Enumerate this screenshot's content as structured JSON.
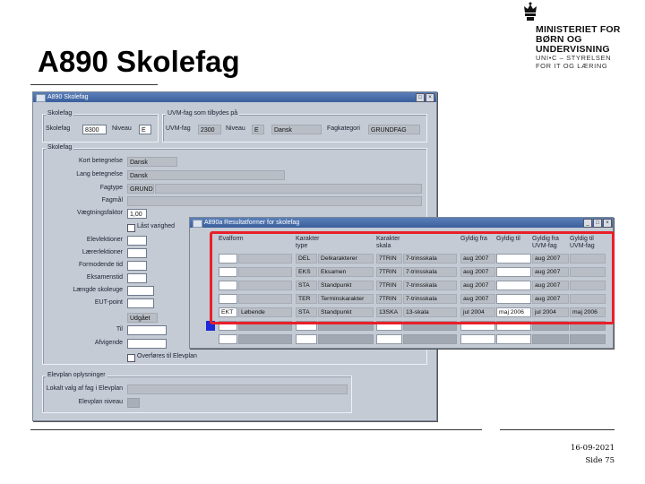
{
  "slide": {
    "title": "A890 Skolefag",
    "date": "16-09-2021",
    "page": "Side 75"
  },
  "logo": {
    "line1": "MINISTERIET FOR",
    "line2": "BØRN OG",
    "line3": "UNDERVISNING",
    "line4": "UNI•C – STYRELSEN",
    "line5": "FOR IT OG LÆRING"
  },
  "main_window": {
    "title": "A890 Skolefag",
    "panel_skolefag": {
      "label": "Skolefag",
      "skolefag_label": "Skolefag",
      "skolefag_value": "8300",
      "niveau_label": "Niveau",
      "niveau_value": "E"
    },
    "panel_uvm": {
      "label": "UVM-fag som tilbydes på",
      "uvmfag_label": "UVM-fag",
      "uvmfag_value": "2300",
      "niveau_label": "Niveau",
      "niveau_value": "E",
      "name_value": "Dansk",
      "fagkategori_label": "Fagkategori",
      "fagkategori_value": "GRUNDFAG"
    },
    "panel_details": {
      "label": "Skolefag",
      "kort_label": "Kort betegnelse",
      "kort_value": "Dansk",
      "lang_label": "Lang betegnelse",
      "lang_value": "Dansk",
      "fagtype_label": "Fagtype",
      "fagtype_value": "GRUNDF",
      "fagmal_label": "Fagmål",
      "vaegt_label": "Vægtningsfaktor",
      "vaegt_value": "1,00",
      "laast_label": "Låst varighed",
      "elevlek_label": "Elevlektioner",
      "laererlek_label": "Lærerlektioner",
      "formodende_label": "Formodende tid",
      "eksamen_label": "Eksamenstid",
      "laengde_label": "Længde skoleuge",
      "eut_label": "EUT-point",
      "status_value": "Udgået",
      "tilg_label": "Til",
      "afvigende_label": "Afvigende",
      "overfores_label": "Overføres til Elevplan"
    },
    "panel_elevplan": {
      "label": "Elevplan oplysninger",
      "lokalt_label": "Lokalt valg af fag i Elevplan",
      "niveau_label": "Elevplan niveau"
    }
  },
  "result_window": {
    "title": "A890a Resultatformer for skolefag",
    "headers": [
      "Evalform",
      "",
      "Karakter type",
      "",
      "Karakter skala",
      "",
      "Gyldig fra",
      "Gyldig til",
      "Gyldig fra UVM-fag",
      "Gyldig til UVM-fag"
    ],
    "rows": [
      [
        "",
        "",
        "DEL",
        "Delkarakterer",
        "7TRIN",
        "7-trinsskala",
        "aug 2007",
        "",
        "aug 2007",
        ""
      ],
      [
        "",
        "",
        "EKS",
        "Eksamen",
        "7TRIN",
        "7-trinsskala",
        "aug 2007",
        "",
        "aug 2007",
        ""
      ],
      [
        "",
        "",
        "STA",
        "Standpunkt",
        "7TRIN",
        "7-trinsskala",
        "aug 2007",
        "",
        "aug 2007",
        ""
      ],
      [
        "",
        "",
        "TER",
        "Terminskarakter",
        "7TRIN",
        "7-trinsskala",
        "aug 2007",
        "",
        "aug 2007",
        ""
      ],
      [
        "EKT",
        "Løbende",
        "STA",
        "Standpunkt",
        "13SKA",
        "13-skala",
        "jul 2004",
        "maj 2006",
        "jul 2004",
        "maj 2006"
      ]
    ]
  }
}
